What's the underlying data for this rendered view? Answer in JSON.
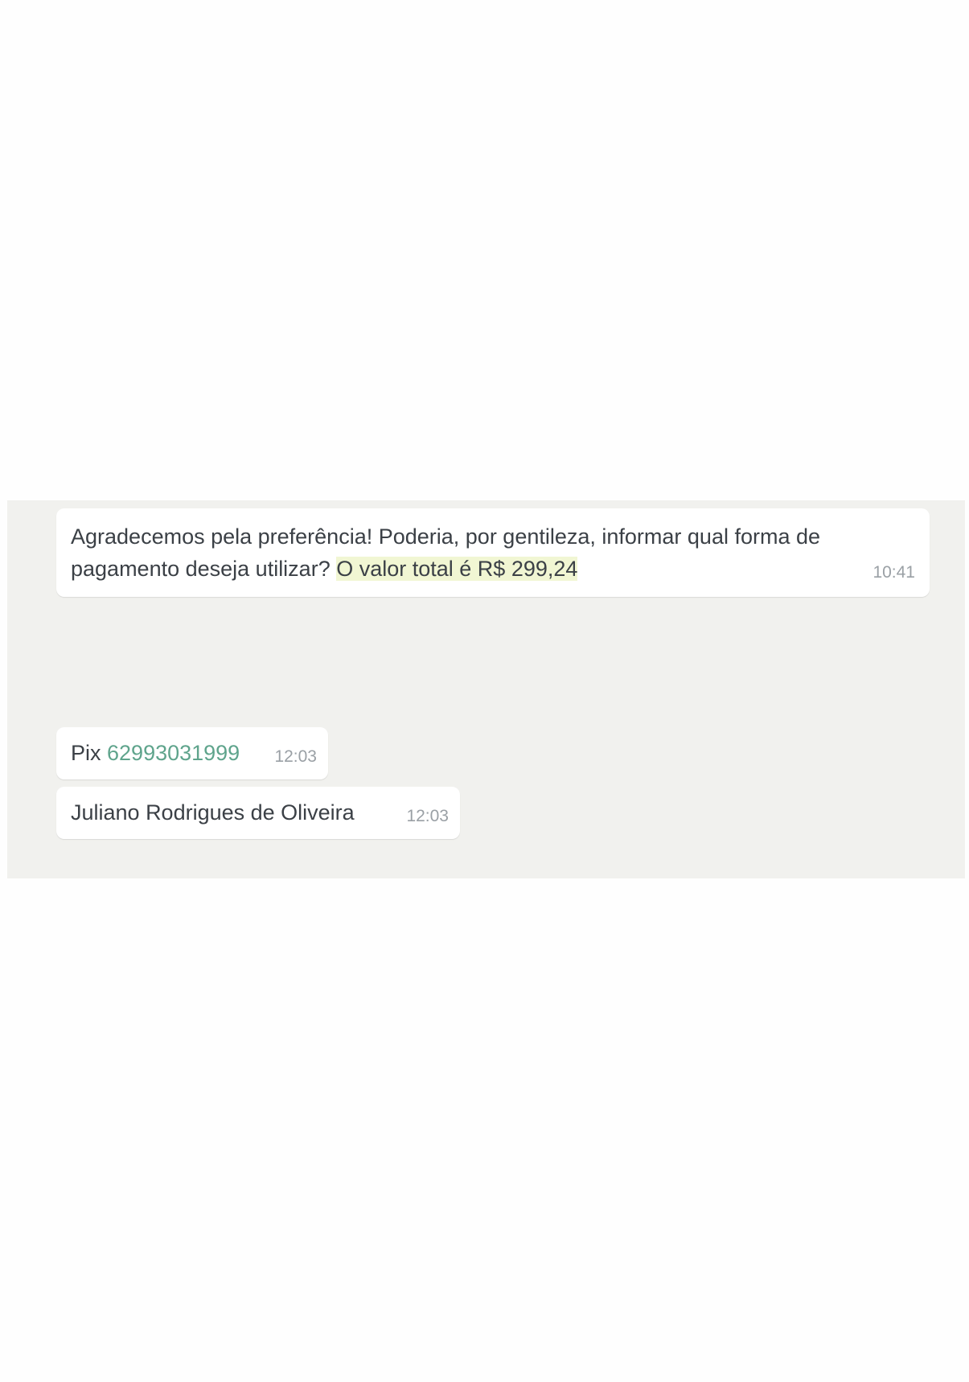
{
  "messages": [
    {
      "text_before": "Agradecemos pela preferência! Poderia, por gentileza, informar qual forma de pagamento deseja utilizar? ",
      "highlighted_text": "O valor total é R$ 299,24",
      "time": "10:41"
    },
    {
      "prefix": "Pix ",
      "phone": "62993031999",
      "time": "12:03"
    },
    {
      "text": "Juliano Rodrigues de Oliveira",
      "time": "12:03"
    }
  ],
  "colors": {
    "chat_background": "#f1f1ee",
    "bubble": "#ffffff",
    "highlight": "#f1f6d3",
    "link": "#5fa48c",
    "timestamp": "#9aa0a5"
  }
}
